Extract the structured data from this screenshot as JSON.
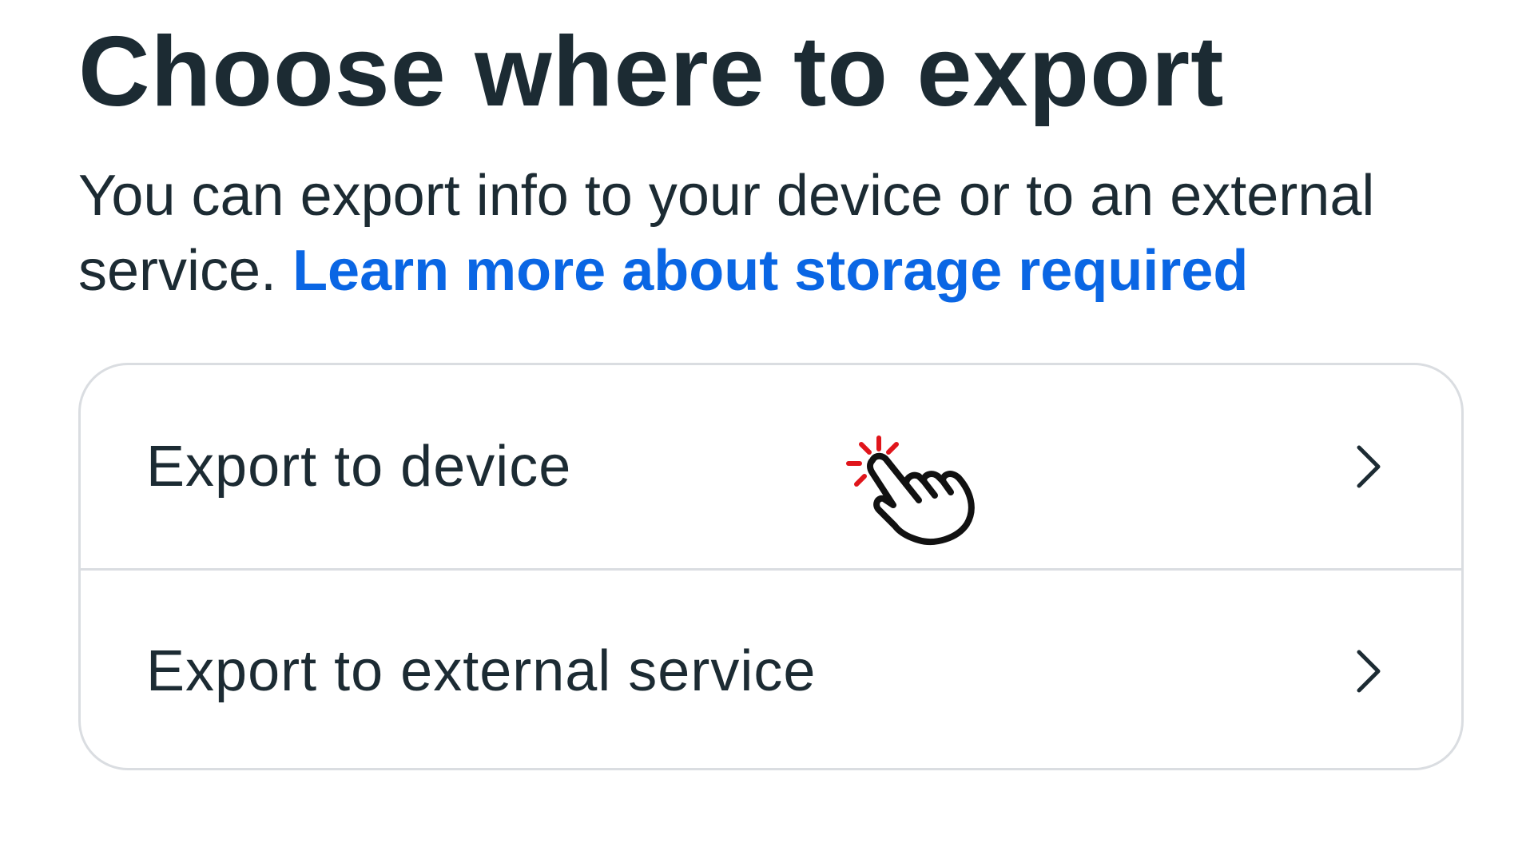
{
  "header": {
    "title": "Choose where to export"
  },
  "description": {
    "text": "You can export info to your device or to an external service.",
    "link_label": "Learn more about storage required"
  },
  "options": [
    {
      "label": "Export to device",
      "icon": "chevron-right-icon"
    },
    {
      "label": "Export to external service",
      "icon": "chevron-right-icon"
    }
  ],
  "cursor": {
    "icon": "tap-hand-cursor-icon"
  },
  "colors": {
    "text": "#1c2b33",
    "link": "#0a66e4",
    "border": "#dadde1",
    "tap_burst": "#e0151b",
    "background": "#ffffff"
  }
}
